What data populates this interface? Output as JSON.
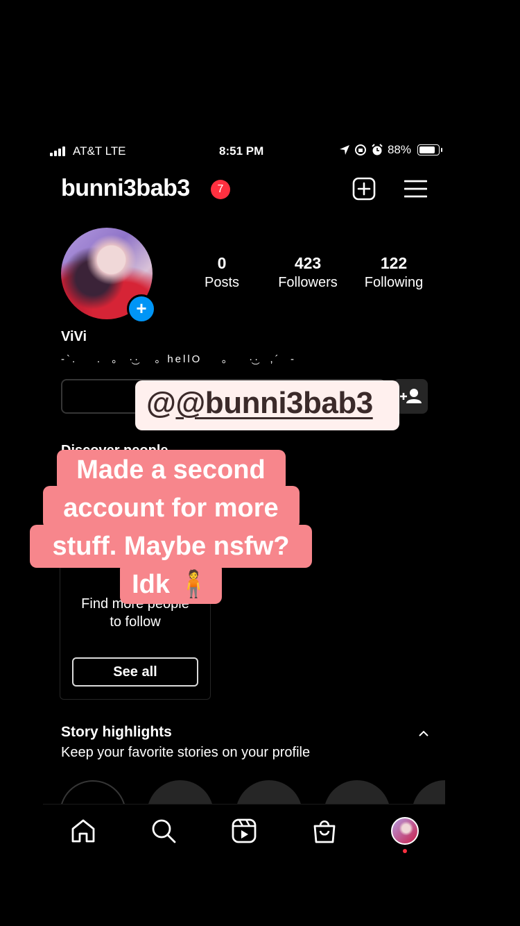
{
  "status_bar": {
    "carrier": "AT&T  LTE",
    "time": "8:51 PM",
    "battery": "88%",
    "icons": [
      "signal-icon",
      "location-arrow-icon",
      "orientation-lock-icon",
      "alarm-icon",
      "battery-icon"
    ]
  },
  "header": {
    "username": "bunni3bab3",
    "notification_count": "7",
    "icons": [
      "new-post-icon",
      "menu-icon"
    ]
  },
  "profile": {
    "stats": [
      {
        "value": "0",
        "label": "Posts"
      },
      {
        "value": "423",
        "label": "Followers"
      },
      {
        "value": "122",
        "label": "Following"
      }
    ],
    "display_name": "ViVi",
    "bio": "-`.    .  ｡  ·͜·   ｡ hellO    ｡    ·͜·  ,´  -"
  },
  "discover": {
    "title": "Discover people",
    "find_text_line1": "Find more people",
    "find_text_line2": "to follow",
    "see_all": "See all"
  },
  "highlights": {
    "title": "Story highlights",
    "subtitle": "Keep your favorite stories on your profile"
  },
  "story_overlay": {
    "mention": "@bunni3bab3",
    "caption": [
      "Made a second",
      "account for more",
      "stuff. Maybe nsfw?",
      "Idk 🧍"
    ]
  },
  "tab_bar": {
    "icons": [
      "home-icon",
      "search-icon",
      "reels-icon",
      "shop-icon",
      "profile-avatar"
    ]
  },
  "colors": {
    "background": "#000000",
    "notification_red": "#ff3040",
    "add_blue": "#0095f6",
    "caption_pink": "#f7868c",
    "mention_bg": "#fff0ee"
  }
}
